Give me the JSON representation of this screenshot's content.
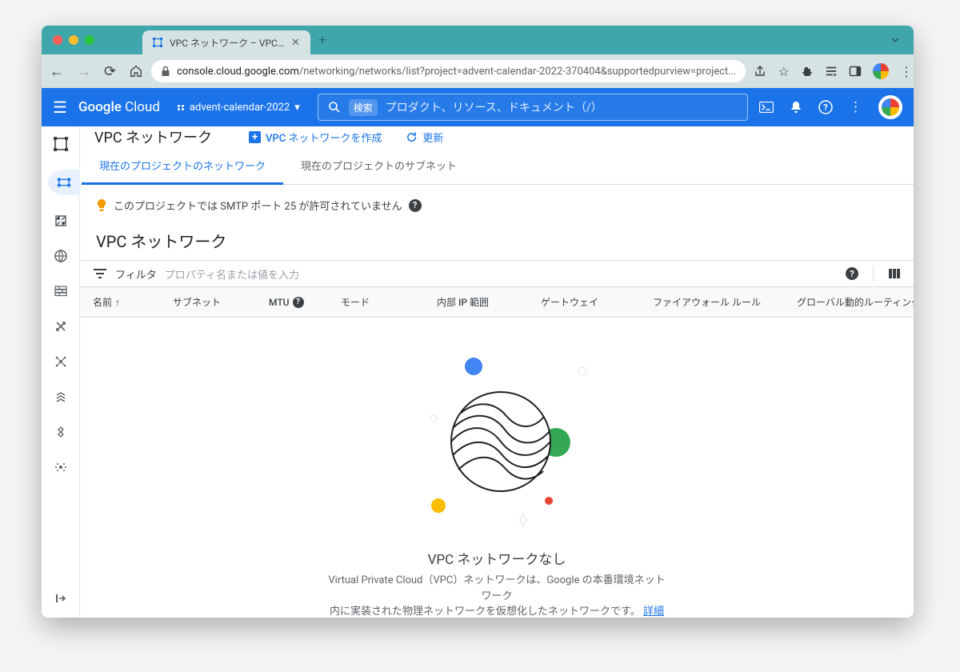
{
  "browser": {
    "tab_title": "VPC ネットワーク – VPC ネット…",
    "url_host": "console.cloud.google.com",
    "url_path": "/networking/networks/list?project=advent-calendar-2022-370404&supportedpurview=project..."
  },
  "header": {
    "logo_a": "Google",
    "logo_b": "Cloud",
    "project": "advent-calendar-2022",
    "search_pill": "検索",
    "search_placeholder": "プロダクト、リソース、ドキュメント（/）"
  },
  "actionbar": {
    "title": "VPC ネットワーク",
    "create": "VPC ネットワークを作成",
    "refresh": "更新"
  },
  "tabs": {
    "networks": "現在のプロジェクトのネットワーク",
    "subnets": "現在のプロジェクトのサブネット"
  },
  "notice": {
    "text": "このプロジェクトでは SMTP ポート 25 が許可されていません"
  },
  "section": {
    "title": "VPC ネットワーク"
  },
  "filter": {
    "label": "フィルタ",
    "placeholder": "プロパティ名または値を入力"
  },
  "columns": {
    "name": "名前",
    "subnets": "サブネット",
    "mtu": "MTU",
    "mode": "モード",
    "ip_range": "内部 IP 範囲",
    "gateways": "ゲートウェイ",
    "firewall": "ファイアウォール ルール",
    "global_routing": "グローバル動的ルーティング"
  },
  "empty": {
    "title": "VPC ネットワークなし",
    "desc1": "Virtual Private Cloud（VPC）ネットワークは、Google の本番環境ネットワーク",
    "desc2": "内に実装された物理ネットワークを仮想化したネットワークです。",
    "learn_more": "詳細"
  }
}
